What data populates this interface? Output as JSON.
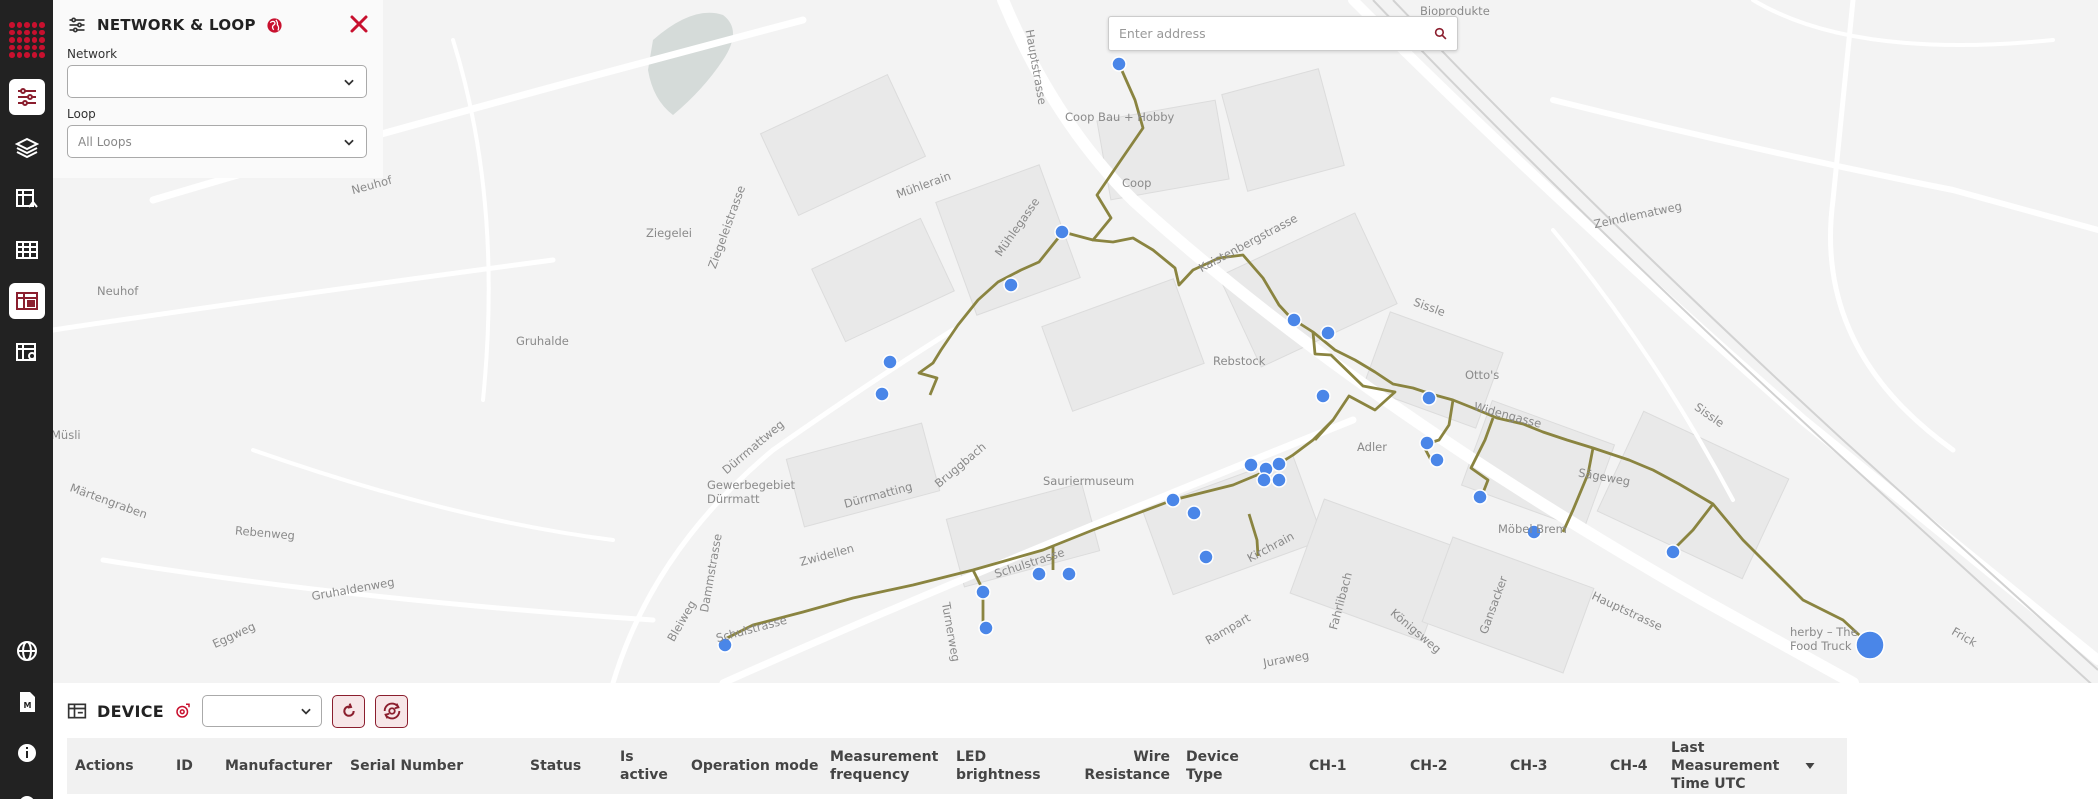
{
  "panel": {
    "title": "NETWORK & LOOP",
    "network_label": "Network",
    "network_value": "",
    "loop_label": "Loop",
    "loop_value": "All Loops"
  },
  "search": {
    "placeholder": "Enter address"
  },
  "map_labels": [
    "Bioprodukte",
    "Coop Bau + Hobby",
    "Coop",
    "Hauptstrasse",
    "Mühlerain",
    "Mühlegasse",
    "Ziegelei",
    "Ziegeleistrasse",
    "Neuhof",
    "Neuhof",
    "Gruhalde",
    "Zeindlematweg",
    "Kaistenbergstrasse",
    "Sissle",
    "Rebstock",
    "Otto's",
    "Widengasse",
    "Adler",
    "Sägeweg",
    "Möbel Brem",
    "Sauriermuseum",
    "Dürrmattweg",
    "Dürrmatting",
    "Gewerbegebiet Dürrmatt",
    "Bruggbach",
    "Zwidellen",
    "Schulstrasse",
    "Turnerweg",
    "Kirchrain",
    "Rampart",
    "Juraweg",
    "Fahrlibach",
    "Königsweg",
    "Gansacker",
    "Hauptstrasse",
    "herby – The Food Truck",
    "Frick",
    "Märtengraben",
    "Rebenweg",
    "Gruhaldenweg",
    "Eggweg",
    "Dammstrasse",
    "Bleiweg",
    "Schulstrasse",
    "Sissle",
    "Müsli"
  ],
  "device": {
    "title": "DEVICE",
    "filter_value": ""
  },
  "table": {
    "columns": [
      "Actions",
      "ID",
      "Manufacturer",
      "Serial Number",
      "Status",
      "Is active",
      "Operation mode",
      "Measurement frequency",
      "LED brightness",
      "Wire Resistance",
      "Device Type",
      "CH-1",
      "CH-2",
      "CH-3",
      "CH-4",
      "Last Measurement Time UTC"
    ]
  },
  "colors": {
    "accent": "#c8102e",
    "rail": "#222222",
    "marker": "#4a86e8",
    "route": "#8a8440"
  },
  "icons": [
    "sliders-icon",
    "layers-icon",
    "table-home-icon",
    "grid-icon",
    "device-table-icon",
    "table-settings-icon",
    "globe-icon",
    "document-m-icon",
    "info-icon",
    "close-icon",
    "search-icon",
    "chevron-down-icon",
    "refresh-icon",
    "refresh-all-icon"
  ]
}
